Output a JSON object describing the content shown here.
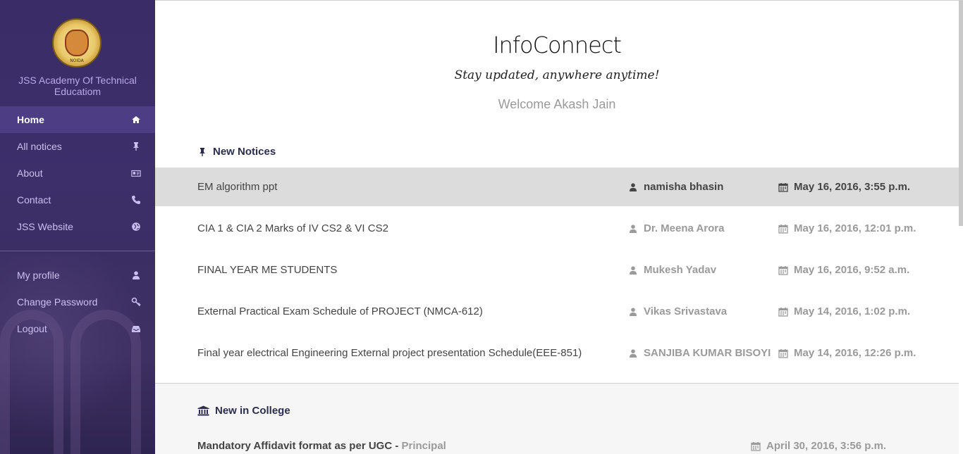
{
  "sidebar": {
    "college_name": "JSS Academy Of Technical Educatiom",
    "logo_text": "NOIDA",
    "nav_items": [
      {
        "label": "Home",
        "icon": "home-icon",
        "active": true
      },
      {
        "label": "All notices",
        "icon": "pin-icon"
      },
      {
        "label": "About",
        "icon": "id-card-icon"
      },
      {
        "label": "Contact",
        "icon": "phone-icon"
      },
      {
        "label": "JSS Website",
        "icon": "globe-icon"
      }
    ],
    "account_items": [
      {
        "label": "My profile",
        "icon": "user-icon"
      },
      {
        "label": "Change Password",
        "icon": "key-icon"
      },
      {
        "label": "Logout",
        "icon": "inbox-icon"
      }
    ]
  },
  "main": {
    "app_title": "InfoConnect",
    "tagline": "Stay updated, anywhere anytime!",
    "welcome": "Welcome Akash Jain",
    "new_notices_heading": "New Notices",
    "notices": [
      {
        "title": "EM algorithm ppt",
        "author": "namisha bhasin",
        "date": "May 16, 2016, 3:55 p.m."
      },
      {
        "title": "CIA 1 & CIA 2 Marks of IV CS2 & VI CS2",
        "author": "Dr. Meena Arora",
        "date": "May 16, 2016, 12:01 p.m."
      },
      {
        "title": "FINAL YEAR ME STUDENTS",
        "author": "Mukesh Yadav",
        "date": "May 16, 2016, 9:52 a.m."
      },
      {
        "title": "External Practical Exam Schedule of PROJECT (NMCA-612)",
        "author": "Vikas Srivastava",
        "date": "May 14, 2016, 1:02 p.m."
      },
      {
        "title": "Final year electrical Engineering External project presentation Schedule(EEE-851)",
        "author": "SANJIBA KUMAR BISOYI",
        "date": "May 14, 2016, 12:26 p.m."
      }
    ],
    "new_in_college_heading": "New in College",
    "college_items": [
      {
        "title": "Mandatory Affidavit format as per UGC",
        "separator": " - ",
        "author": "Principal",
        "date": "April 30, 2016, 3:56 p.m."
      }
    ]
  },
  "colors": {
    "sidebar_bg": "#3a2c66",
    "sidebar_active": "#4d3d84",
    "sidebar_text": "#c9bff0",
    "heading": "#2c2c50",
    "muted": "#9a9a9a",
    "hover_row": "#dcdcdc"
  }
}
